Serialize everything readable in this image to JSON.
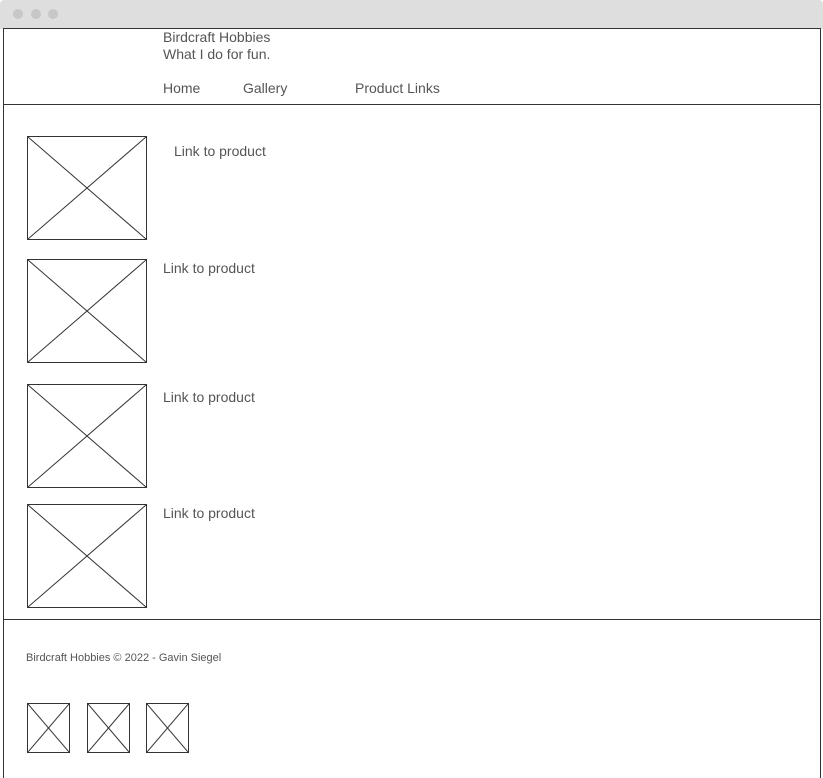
{
  "site": {
    "title": "Birdcraft Hobbies",
    "tagline": "What I do for fun."
  },
  "nav": {
    "items": [
      {
        "label": "Home"
      },
      {
        "label": "Gallery"
      },
      {
        "label": "Product Links"
      }
    ]
  },
  "products": [
    {
      "image_icon": "image-placeholder-icon",
      "link_label": "Link to product"
    },
    {
      "image_icon": "image-placeholder-icon",
      "link_label": "Link to product"
    },
    {
      "image_icon": "image-placeholder-icon",
      "link_label": "Link to product"
    },
    {
      "image_icon": "image-placeholder-icon",
      "link_label": "Link to product"
    }
  ],
  "footer": {
    "copyright": "Birdcraft Hobbies © 2022 - Gavin Siegel",
    "social_icons": [
      "image-placeholder-icon",
      "image-placeholder-icon",
      "image-placeholder-icon"
    ]
  },
  "colors": {
    "text": "#555555",
    "border": "#333333",
    "titlebar": "#dedede"
  }
}
